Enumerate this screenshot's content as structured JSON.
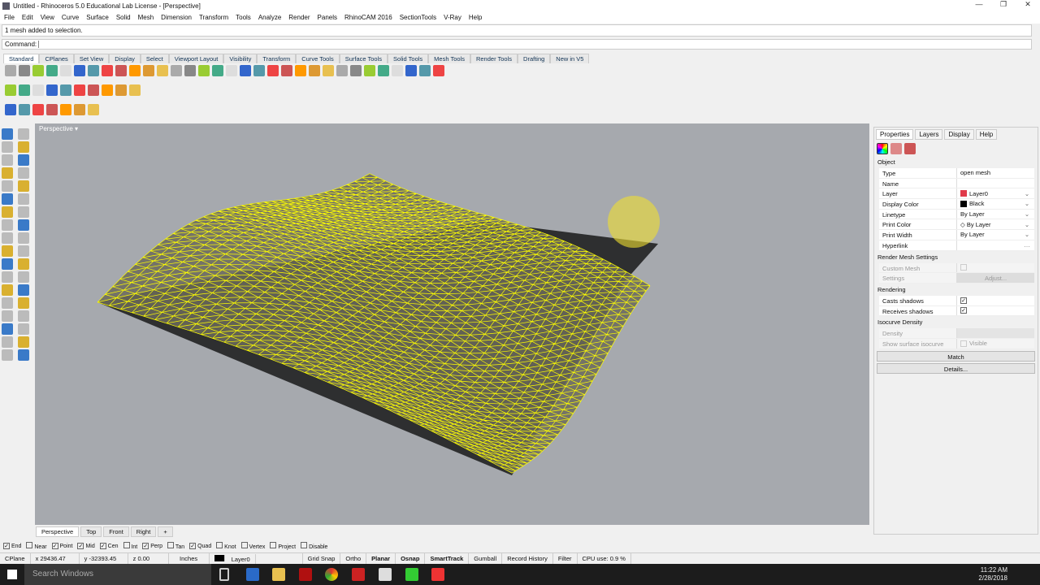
{
  "window": {
    "title": "Untitled - Rhinoceros 5.0 Educational Lab License - [Perspective]"
  },
  "menu": [
    "File",
    "Edit",
    "View",
    "Curve",
    "Surface",
    "Solid",
    "Mesh",
    "Dimension",
    "Transform",
    "Tools",
    "Analyze",
    "Render",
    "Panels",
    "RhinoCAM 2016",
    "SectionTools",
    "V-Ray",
    "Help"
  ],
  "command": {
    "history": "1 mesh added to selection.",
    "label": "Command:",
    "value": ""
  },
  "toolbar_tabs": [
    "Standard",
    "CPlanes",
    "Set View",
    "Display",
    "Select",
    "Viewport Layout",
    "Visibility",
    "Transform",
    "Curve Tools",
    "Surface Tools",
    "Solid Tools",
    "Mesh Tools",
    "Render Tools",
    "Drafting",
    "New in V5"
  ],
  "viewport": {
    "label": "Perspective",
    "tabs": [
      "Perspective",
      "Top",
      "Front",
      "Right"
    ],
    "mesh_color": "#ffff00",
    "background": "#a6a9ae"
  },
  "panel": {
    "tabs": [
      "Properties",
      "Layers",
      "Display",
      "Help"
    ],
    "object_header": "Object",
    "rows": [
      {
        "k": "Type",
        "v": "open mesh"
      },
      {
        "k": "Name",
        "v": ""
      },
      {
        "k": "Layer",
        "v": "Layer0",
        "swatch": "#e03a4a"
      },
      {
        "k": "Display Color",
        "v": "Black",
        "swatch": "#000000"
      },
      {
        "k": "Linetype",
        "v": "By Layer"
      },
      {
        "k": "Print Color",
        "v": "◇ By Layer"
      },
      {
        "k": "Print Width",
        "v": "By Layer"
      },
      {
        "k": "Hyperlink",
        "v": ""
      }
    ],
    "render_mesh_header": "Render Mesh Settings",
    "custom_mesh": "Custom Mesh",
    "settings": "Settings",
    "adjust": "Adjust...",
    "rendering_header": "Rendering",
    "casts_shadows": "Casts shadows",
    "receives_shadows": "Receives shadows",
    "isocurve_header": "Isocurve Density",
    "density": "Density",
    "show_isocurve": "Show surface isocurve",
    "visible": "Visible",
    "match": "Match",
    "details": "Details..."
  },
  "osnap": [
    {
      "label": "End",
      "checked": true
    },
    {
      "label": "Near",
      "checked": false
    },
    {
      "label": "Point",
      "checked": true
    },
    {
      "label": "Mid",
      "checked": true
    },
    {
      "label": "Cen",
      "checked": true
    },
    {
      "label": "Int",
      "checked": false
    },
    {
      "label": "Perp",
      "checked": true
    },
    {
      "label": "Tan",
      "checked": false
    },
    {
      "label": "Quad",
      "checked": true
    },
    {
      "label": "Knot",
      "checked": false
    },
    {
      "label": "Vertex",
      "checked": false
    },
    {
      "label": "Project",
      "checked": false
    },
    {
      "label": "Disable",
      "checked": false
    }
  ],
  "status": {
    "cplane": "CPlane",
    "x": "x 29436.47",
    "y": "y -32393.45",
    "z": "z 0.00",
    "units": "Inches",
    "layer": "Layer0",
    "grid_snap": "Grid Snap",
    "ortho": "Ortho",
    "planar": "Planar",
    "osnap": "Osnap",
    "smarttrack": "SmartTrack",
    "gumball": "Gumball",
    "record_history": "Record History",
    "filter": "Filter",
    "cpu": "CPU use: 0.9 %"
  },
  "taskbar": {
    "search": "Search Windows",
    "time": "11:22 AM",
    "date": "2/28/2018"
  }
}
